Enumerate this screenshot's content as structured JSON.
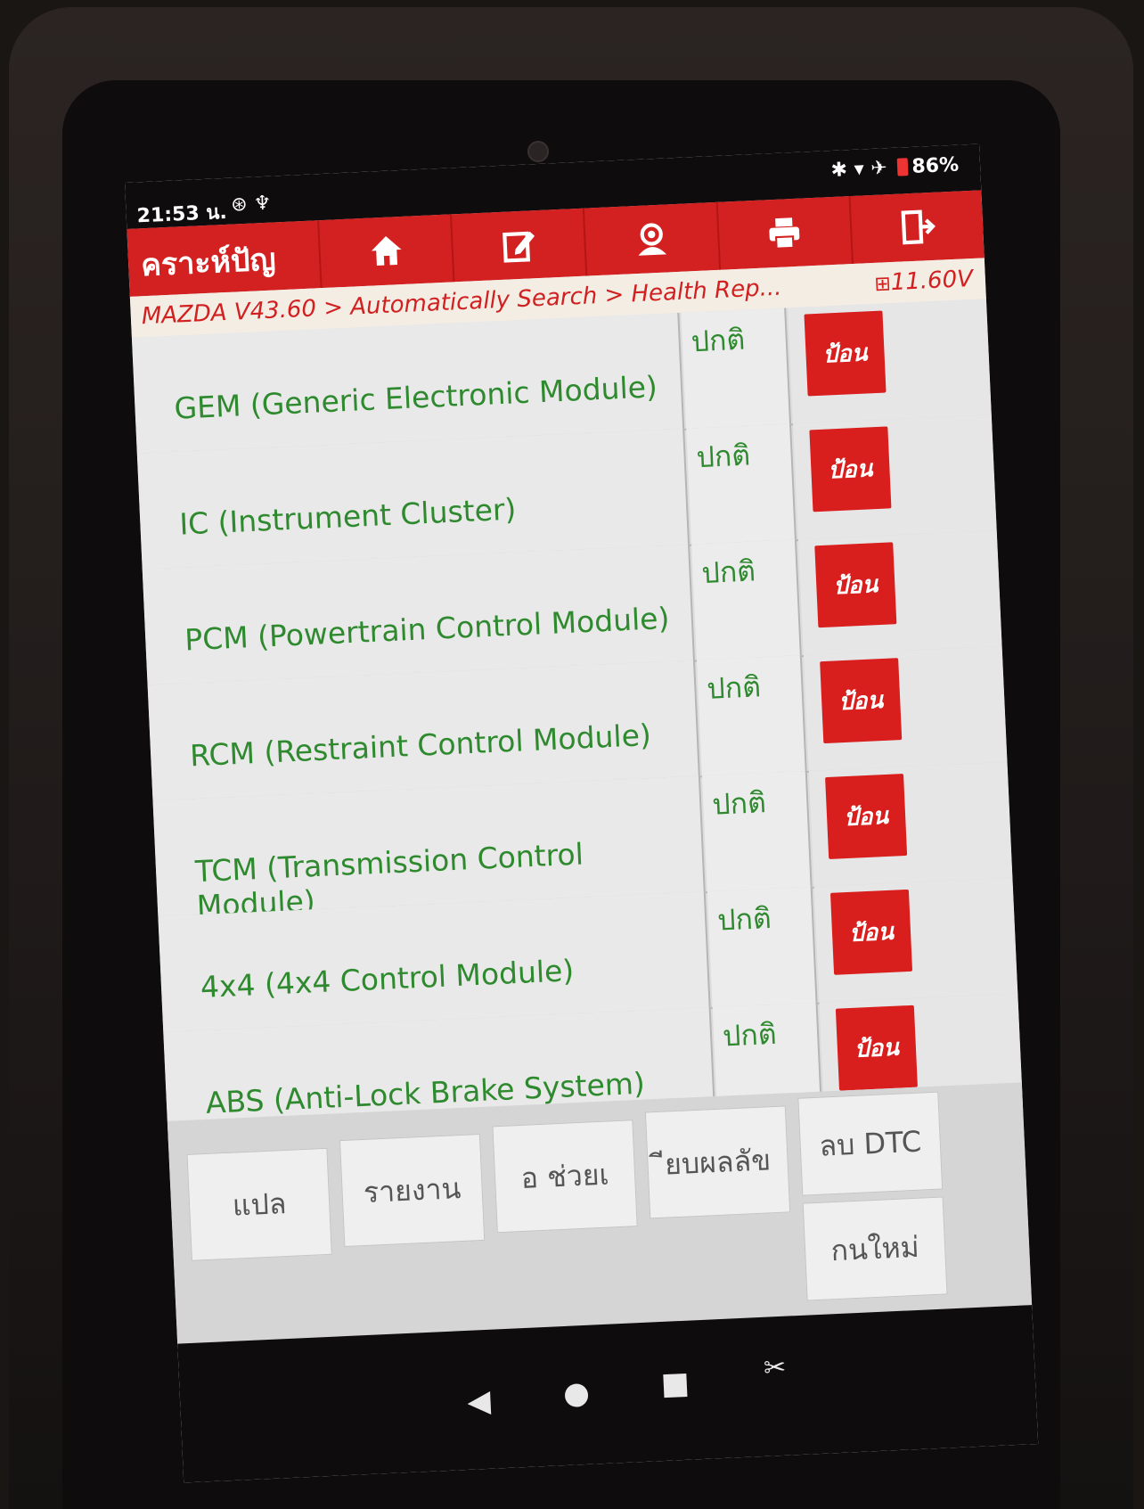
{
  "status_bar": {
    "time": "21:53 น.",
    "left_icons": "⊛ ♆",
    "right_icons": "✱ ▾ ✈",
    "battery": "86%"
  },
  "toolbar": {
    "title": "คราะห์ปัญ",
    "buttons": [
      "home-icon",
      "edit-icon",
      "support-icon",
      "print-icon",
      "exit-icon"
    ]
  },
  "breadcrumb": {
    "path": "MAZDA V43.60 > Automatically Search > Health Rep...",
    "voltage": "11.60V"
  },
  "modules": [
    {
      "name": "GEM (Generic Electronic Module)",
      "status": "ปกติ",
      "action": "ป้อน"
    },
    {
      "name": "IC (Instrument Cluster)",
      "status": "ปกติ",
      "action": "ป้อน"
    },
    {
      "name": "PCM (Powertrain Control Module)",
      "status": "ปกติ",
      "action": "ป้อน"
    },
    {
      "name": "RCM (Restraint Control Module)",
      "status": "ปกติ",
      "action": "ป้อน"
    },
    {
      "name": "TCM (Transmission Control Module)",
      "status": "ปกติ",
      "action": "ป้อน"
    },
    {
      "name": "4x4 (4x4 Control Module)",
      "status": "ปกติ",
      "action": "ป้อน"
    },
    {
      "name": "ABS (Anti-Lock Brake System)",
      "status": "ปกติ",
      "action": "ป้อน"
    }
  ],
  "bottom_buttons": {
    "translate": "แปล",
    "report": "รายงาน",
    "help": "อ    ช่วยเ",
    "compare": "ียบผลลัข",
    "clear_dtc": "ลบ DTC",
    "restart": "กนใหม่"
  },
  "colors": {
    "accent_red": "#d32121",
    "module_text_green": "#2f8a2f",
    "breadcrumb_bg": "#f4ede4"
  }
}
